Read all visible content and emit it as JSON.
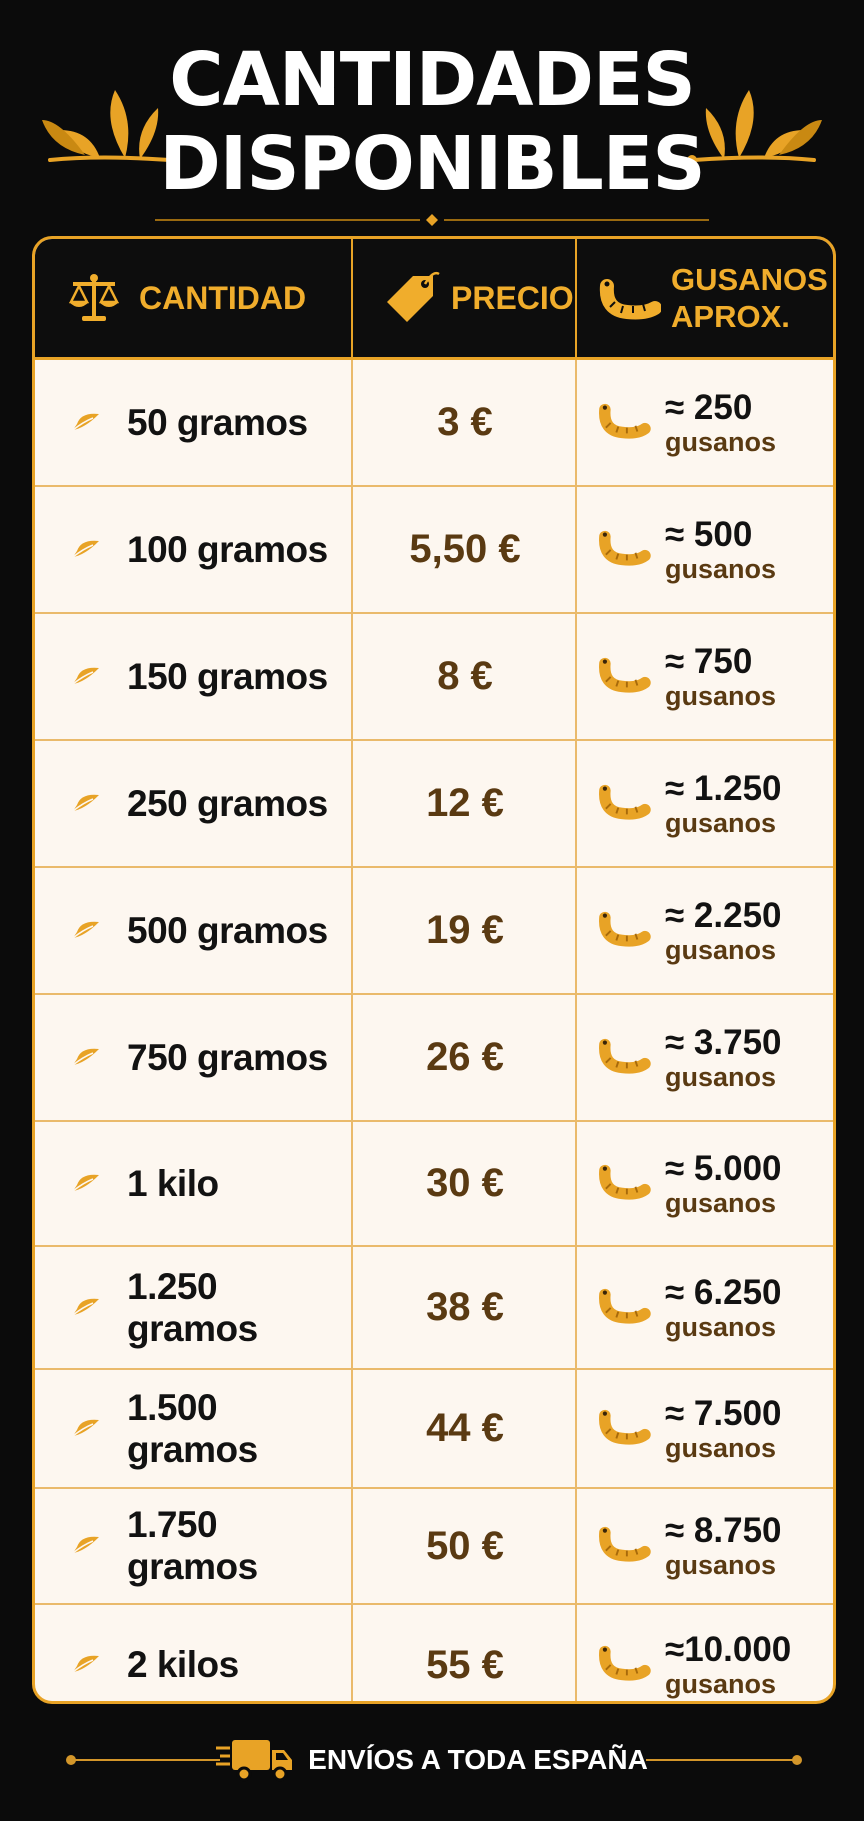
{
  "title": {
    "line1": "CANTIDADES",
    "line2": "DISPONIBLES"
  },
  "colors": {
    "background": "#0b0b0b",
    "accent": "#e8a326",
    "table_bg": "#fdf7f0",
    "price": "#5a3a12"
  },
  "table": {
    "headers": {
      "quantity": {
        "label": "CANTIDAD",
        "icon": "scale-icon"
      },
      "price": {
        "label": "PRECIO",
        "icon": "price-tag-icon"
      },
      "worms": {
        "line1": "GUSANOS",
        "line2": "APROX.",
        "icon": "worm-icon"
      }
    },
    "rows": [
      {
        "quantity": "50 gramos",
        "price": "3 €",
        "worms": "≈ 250",
        "unit": "gusanos"
      },
      {
        "quantity": "100 gramos",
        "price": "5,50 €",
        "worms": "≈ 500",
        "unit": "gusanos"
      },
      {
        "quantity": "150 gramos",
        "price": "8 €",
        "worms": "≈ 750",
        "unit": "gusanos"
      },
      {
        "quantity": "250 gramos",
        "price": "12 €",
        "worms": "≈ 1.250",
        "unit": "gusanos"
      },
      {
        "quantity": "500 gramos",
        "price": "19 €",
        "worms": "≈ 2.250",
        "unit": "gusanos"
      },
      {
        "quantity": "750 gramos",
        "price": "26 €",
        "worms": "≈ 3.750",
        "unit": "gusanos"
      },
      {
        "quantity": "1 kilo",
        "price": "30 €",
        "worms": "≈ 5.000",
        "unit": "gusanos"
      },
      {
        "quantity": "1.250 gramos",
        "price": "38 €",
        "worms": "≈ 6.250",
        "unit": "gusanos"
      },
      {
        "quantity": "1.500 gramos",
        "price": "44 €",
        "worms": "≈ 7.500",
        "unit": "gusanos"
      },
      {
        "quantity": "1.750 gramos",
        "price": "50 €",
        "worms": "≈ 8.750",
        "unit": "gusanos"
      },
      {
        "quantity": "2 kilos",
        "price": "55 €",
        "worms": "≈10.000",
        "unit": "gusanos"
      }
    ]
  },
  "footer": {
    "text": "ENVÍOS A TODA ESPAÑA",
    "icon": "delivery-truck-icon"
  }
}
